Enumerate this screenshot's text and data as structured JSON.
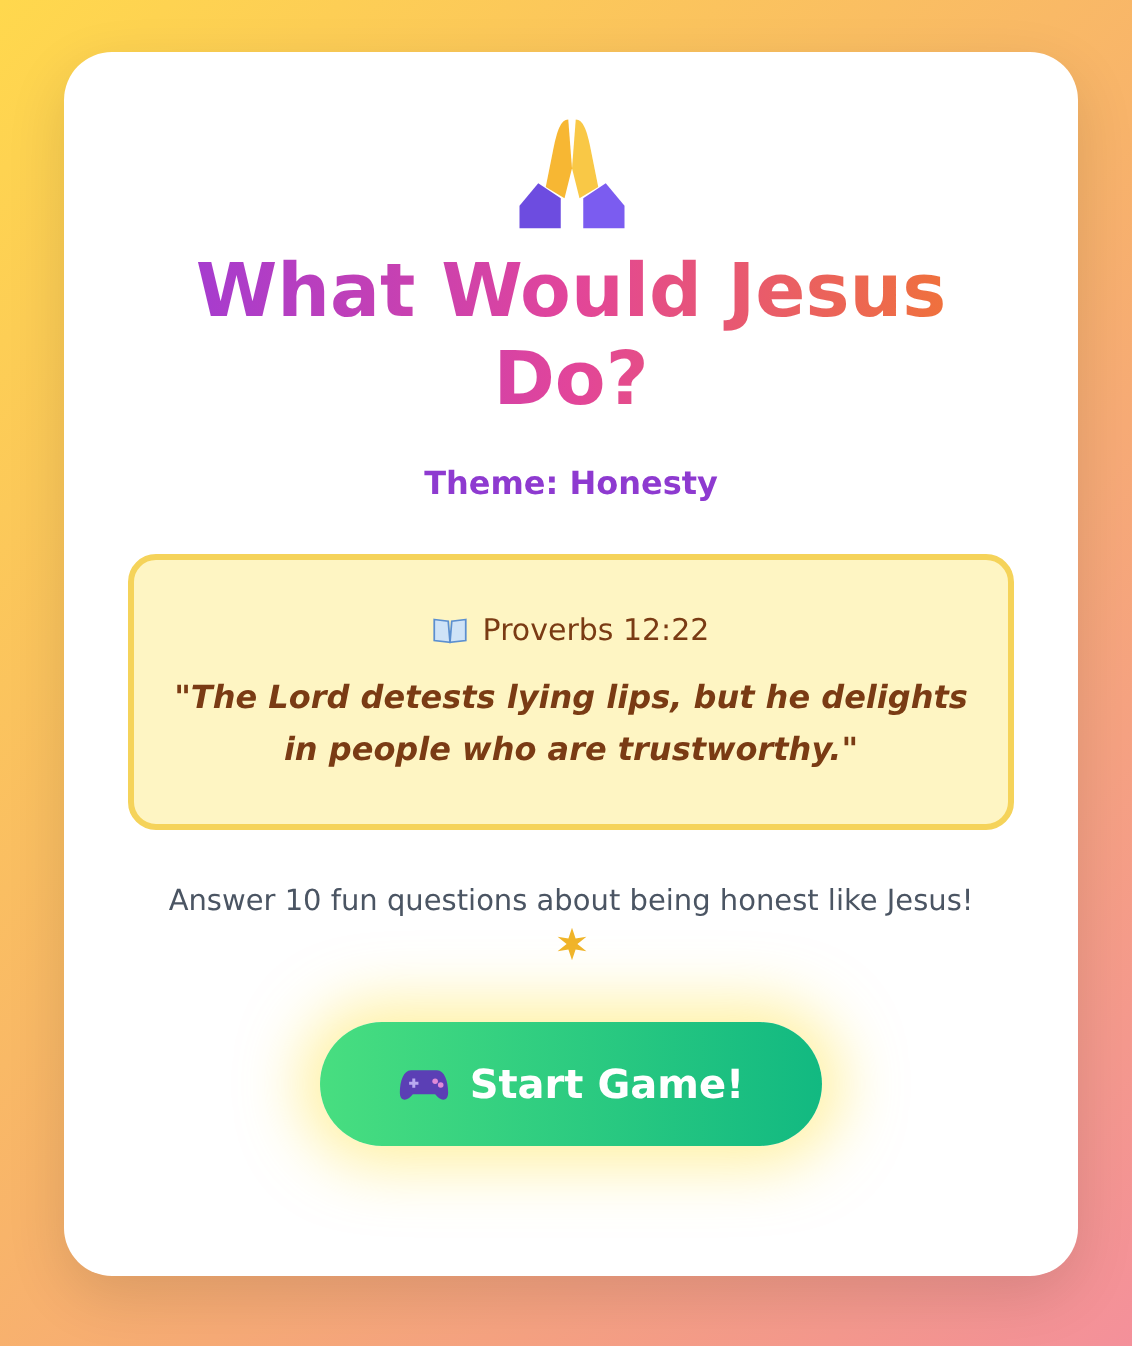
{
  "title": "What Would Jesus Do?",
  "theme": "Theme: Honesty",
  "verse": {
    "reference": "Proverbs 12:22",
    "quote": "\"The Lord detests lying lips, but he delights in people who are trustworthy.\""
  },
  "intro": "Answer 10 fun questions about being honest like Jesus!",
  "start_button": "Start Game!"
}
